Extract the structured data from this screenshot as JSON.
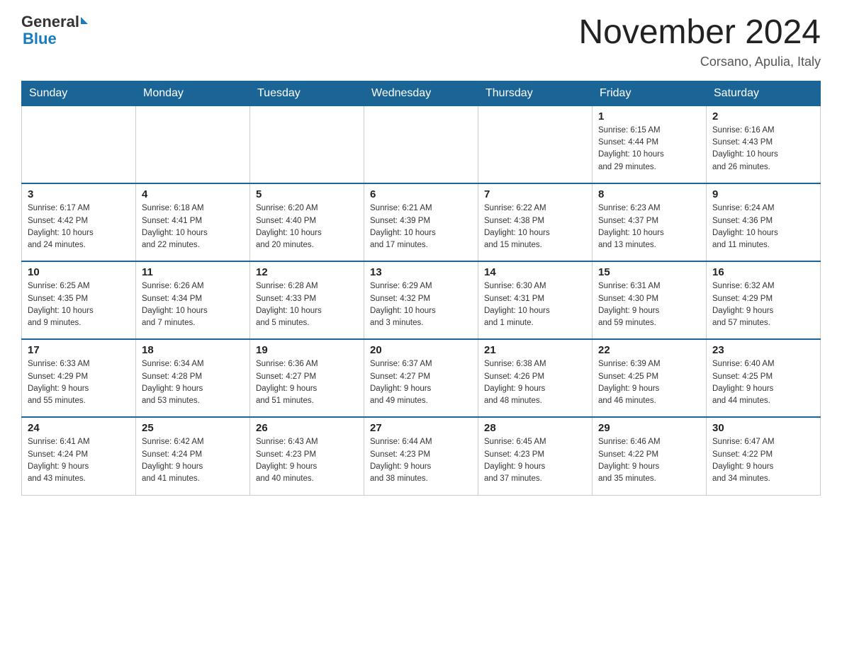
{
  "header": {
    "logo_general": "General",
    "logo_blue": "Blue",
    "month_title": "November 2024",
    "location": "Corsano, Apulia, Italy"
  },
  "days_of_week": [
    "Sunday",
    "Monday",
    "Tuesday",
    "Wednesday",
    "Thursday",
    "Friday",
    "Saturday"
  ],
  "weeks": [
    [
      {
        "day": "",
        "info": ""
      },
      {
        "day": "",
        "info": ""
      },
      {
        "day": "",
        "info": ""
      },
      {
        "day": "",
        "info": ""
      },
      {
        "day": "",
        "info": ""
      },
      {
        "day": "1",
        "info": "Sunrise: 6:15 AM\nSunset: 4:44 PM\nDaylight: 10 hours\nand 29 minutes."
      },
      {
        "day": "2",
        "info": "Sunrise: 6:16 AM\nSunset: 4:43 PM\nDaylight: 10 hours\nand 26 minutes."
      }
    ],
    [
      {
        "day": "3",
        "info": "Sunrise: 6:17 AM\nSunset: 4:42 PM\nDaylight: 10 hours\nand 24 minutes."
      },
      {
        "day": "4",
        "info": "Sunrise: 6:18 AM\nSunset: 4:41 PM\nDaylight: 10 hours\nand 22 minutes."
      },
      {
        "day": "5",
        "info": "Sunrise: 6:20 AM\nSunset: 4:40 PM\nDaylight: 10 hours\nand 20 minutes."
      },
      {
        "day": "6",
        "info": "Sunrise: 6:21 AM\nSunset: 4:39 PM\nDaylight: 10 hours\nand 17 minutes."
      },
      {
        "day": "7",
        "info": "Sunrise: 6:22 AM\nSunset: 4:38 PM\nDaylight: 10 hours\nand 15 minutes."
      },
      {
        "day": "8",
        "info": "Sunrise: 6:23 AM\nSunset: 4:37 PM\nDaylight: 10 hours\nand 13 minutes."
      },
      {
        "day": "9",
        "info": "Sunrise: 6:24 AM\nSunset: 4:36 PM\nDaylight: 10 hours\nand 11 minutes."
      }
    ],
    [
      {
        "day": "10",
        "info": "Sunrise: 6:25 AM\nSunset: 4:35 PM\nDaylight: 10 hours\nand 9 minutes."
      },
      {
        "day": "11",
        "info": "Sunrise: 6:26 AM\nSunset: 4:34 PM\nDaylight: 10 hours\nand 7 minutes."
      },
      {
        "day": "12",
        "info": "Sunrise: 6:28 AM\nSunset: 4:33 PM\nDaylight: 10 hours\nand 5 minutes."
      },
      {
        "day": "13",
        "info": "Sunrise: 6:29 AM\nSunset: 4:32 PM\nDaylight: 10 hours\nand 3 minutes."
      },
      {
        "day": "14",
        "info": "Sunrise: 6:30 AM\nSunset: 4:31 PM\nDaylight: 10 hours\nand 1 minute."
      },
      {
        "day": "15",
        "info": "Sunrise: 6:31 AM\nSunset: 4:30 PM\nDaylight: 9 hours\nand 59 minutes."
      },
      {
        "day": "16",
        "info": "Sunrise: 6:32 AM\nSunset: 4:29 PM\nDaylight: 9 hours\nand 57 minutes."
      }
    ],
    [
      {
        "day": "17",
        "info": "Sunrise: 6:33 AM\nSunset: 4:29 PM\nDaylight: 9 hours\nand 55 minutes."
      },
      {
        "day": "18",
        "info": "Sunrise: 6:34 AM\nSunset: 4:28 PM\nDaylight: 9 hours\nand 53 minutes."
      },
      {
        "day": "19",
        "info": "Sunrise: 6:36 AM\nSunset: 4:27 PM\nDaylight: 9 hours\nand 51 minutes."
      },
      {
        "day": "20",
        "info": "Sunrise: 6:37 AM\nSunset: 4:27 PM\nDaylight: 9 hours\nand 49 minutes."
      },
      {
        "day": "21",
        "info": "Sunrise: 6:38 AM\nSunset: 4:26 PM\nDaylight: 9 hours\nand 48 minutes."
      },
      {
        "day": "22",
        "info": "Sunrise: 6:39 AM\nSunset: 4:25 PM\nDaylight: 9 hours\nand 46 minutes."
      },
      {
        "day": "23",
        "info": "Sunrise: 6:40 AM\nSunset: 4:25 PM\nDaylight: 9 hours\nand 44 minutes."
      }
    ],
    [
      {
        "day": "24",
        "info": "Sunrise: 6:41 AM\nSunset: 4:24 PM\nDaylight: 9 hours\nand 43 minutes."
      },
      {
        "day": "25",
        "info": "Sunrise: 6:42 AM\nSunset: 4:24 PM\nDaylight: 9 hours\nand 41 minutes."
      },
      {
        "day": "26",
        "info": "Sunrise: 6:43 AM\nSunset: 4:23 PM\nDaylight: 9 hours\nand 40 minutes."
      },
      {
        "day": "27",
        "info": "Sunrise: 6:44 AM\nSunset: 4:23 PM\nDaylight: 9 hours\nand 38 minutes."
      },
      {
        "day": "28",
        "info": "Sunrise: 6:45 AM\nSunset: 4:23 PM\nDaylight: 9 hours\nand 37 minutes."
      },
      {
        "day": "29",
        "info": "Sunrise: 6:46 AM\nSunset: 4:22 PM\nDaylight: 9 hours\nand 35 minutes."
      },
      {
        "day": "30",
        "info": "Sunrise: 6:47 AM\nSunset: 4:22 PM\nDaylight: 9 hours\nand 34 minutes."
      }
    ]
  ]
}
